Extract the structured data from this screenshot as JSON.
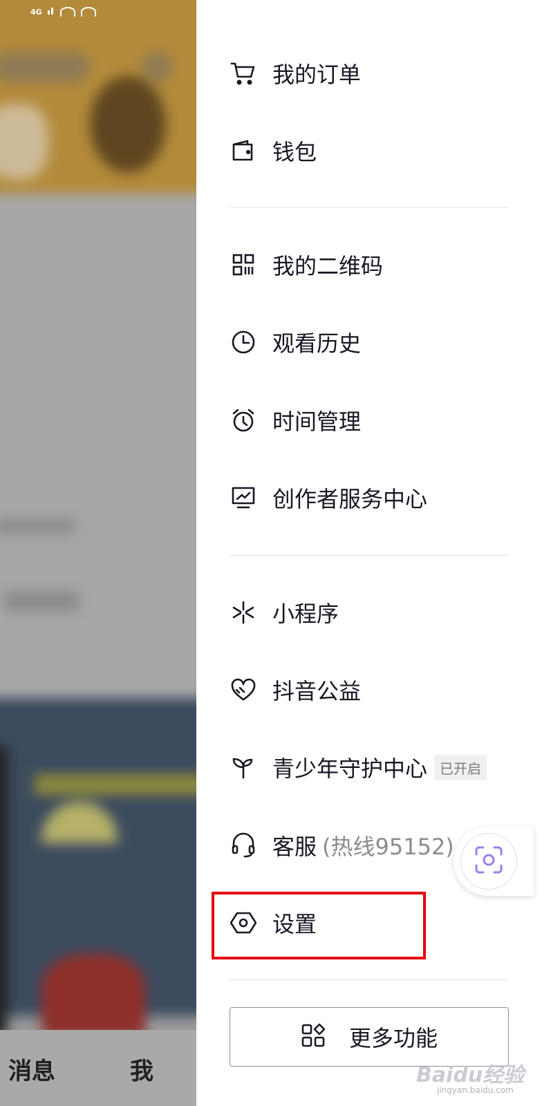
{
  "status_bar": {
    "network": "4G"
  },
  "background_tabs": [
    {
      "label": "消息"
    },
    {
      "label": "我"
    }
  ],
  "menu": {
    "items": [
      {
        "id": "orders",
        "label": "我的订单",
        "icon": "cart-icon"
      },
      {
        "id": "wallet",
        "label": "钱包",
        "icon": "wallet-icon"
      },
      {
        "id": "qrcode",
        "label": "我的二维码",
        "icon": "qr-code-icon"
      },
      {
        "id": "history",
        "label": "观看历史",
        "icon": "clock-icon"
      },
      {
        "id": "time",
        "label": "时间管理",
        "icon": "alarm-clock-icon"
      },
      {
        "id": "creator",
        "label": "创作者服务中心",
        "icon": "monitor-chart-icon"
      },
      {
        "id": "miniapp",
        "label": "小程序",
        "icon": "asterisk-icon"
      },
      {
        "id": "charity",
        "label": "抖音公益",
        "icon": "heart-icon"
      },
      {
        "id": "youth",
        "label": "青少年守护中心",
        "badge": "已开启",
        "icon": "sprout-icon"
      },
      {
        "id": "service",
        "label": "客服",
        "sub": "(热线95152)",
        "icon": "headset-icon"
      },
      {
        "id": "settings",
        "label": "设置",
        "icon": "hexagon-settings-icon"
      }
    ],
    "more_button": {
      "label": "更多功能",
      "icon": "apps-grid-icon"
    }
  },
  "colors": {
    "highlight": "#e60012",
    "text": "#161823",
    "floating_icon": "#9b7ff0"
  },
  "watermark": {
    "text": "Baidu经验",
    "sub": "jingyan.baidu.com"
  }
}
